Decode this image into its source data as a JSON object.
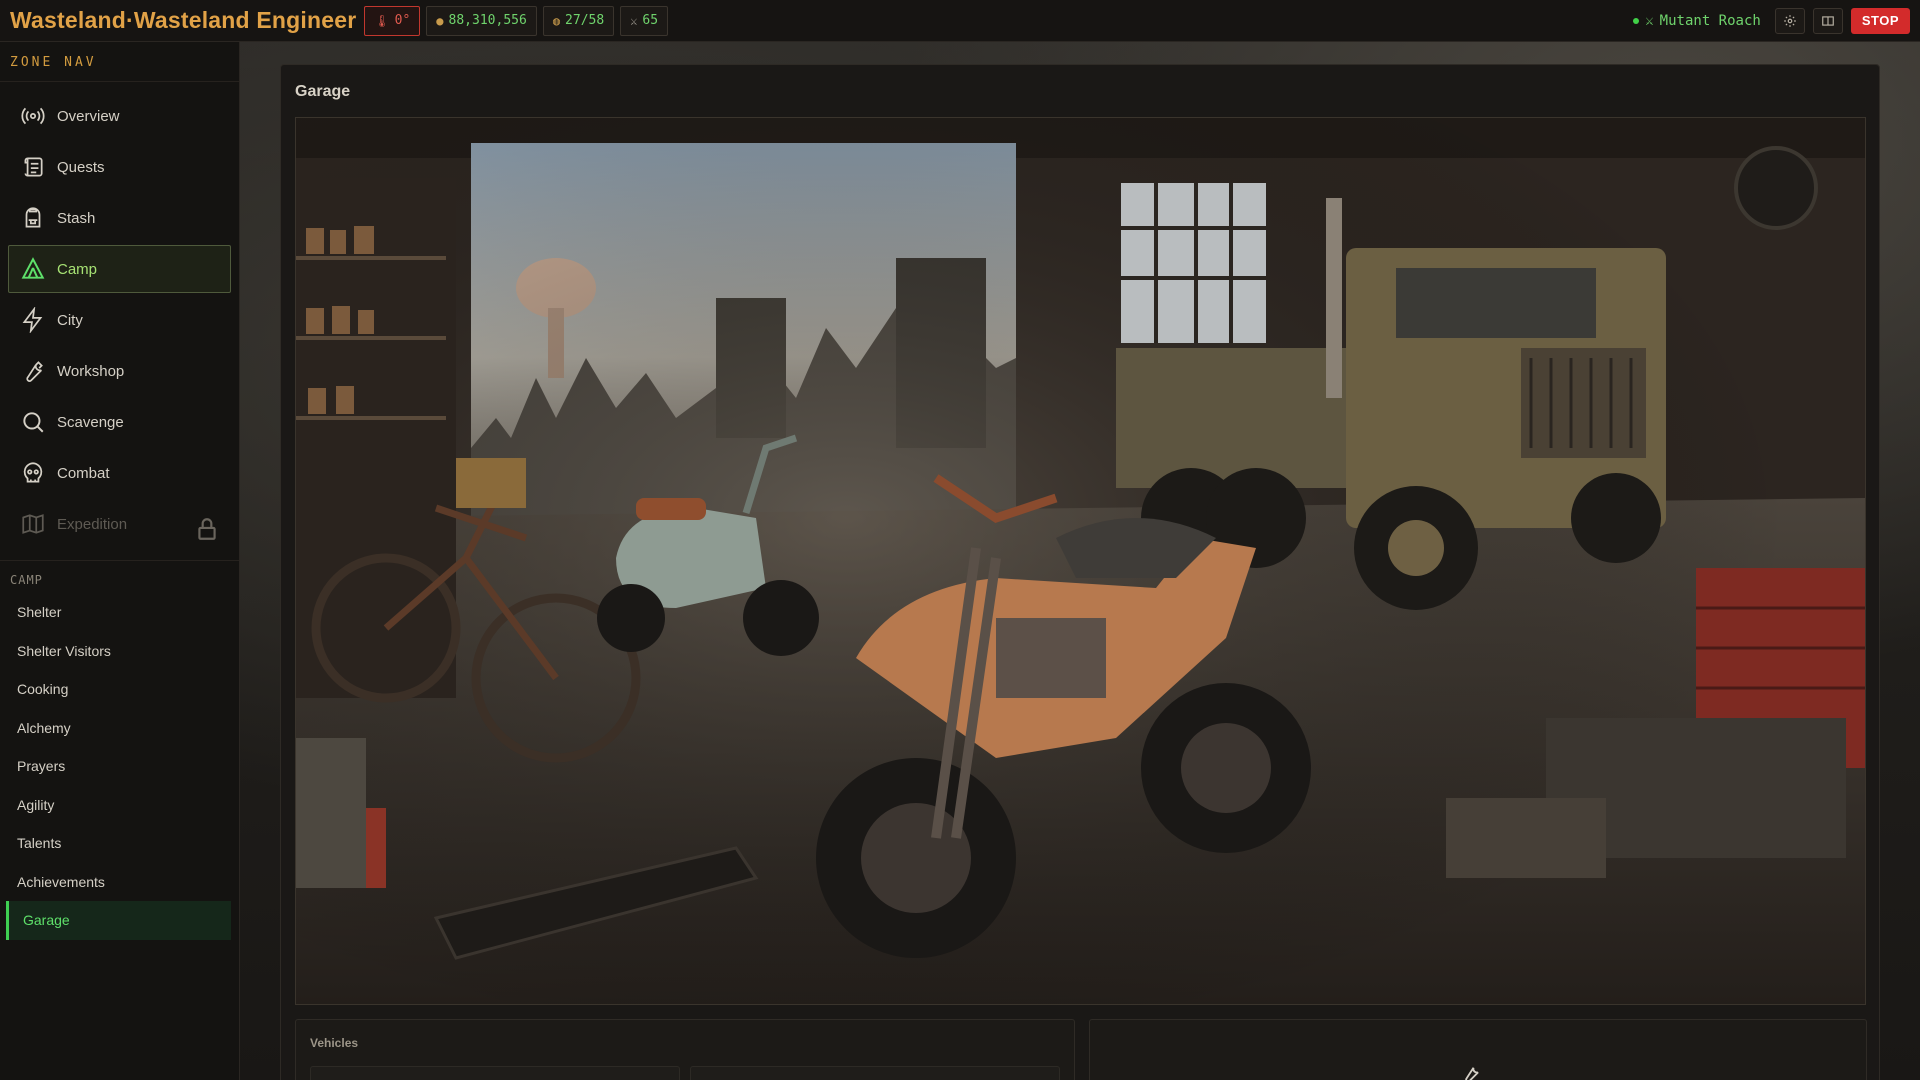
{
  "app": {
    "title": "Wasteland·Wasteland Engineer"
  },
  "topbar": {
    "stats": [
      {
        "icon": "thermometer-icon",
        "value": "0°",
        "alert": true
      },
      {
        "icon": "coin-icon",
        "value": "88,310,556"
      },
      {
        "icon": "capacity-icon",
        "value": "27/58"
      },
      {
        "icon": "swords-icon",
        "value": "65"
      }
    ],
    "enemy_label": "Mutant Roach",
    "stop_label": "STOP"
  },
  "sidebar": {
    "zone_nav_title": "ZONE NAV",
    "items": [
      {
        "label": "Overview",
        "icon": "radar-icon"
      },
      {
        "label": "Quests",
        "icon": "scroll-icon"
      },
      {
        "label": "Stash",
        "icon": "backpack-icon"
      },
      {
        "label": "Camp",
        "icon": "tent-icon",
        "active": true
      },
      {
        "label": "City",
        "icon": "lightning-icon"
      },
      {
        "label": "Workshop",
        "icon": "wrench-icon"
      },
      {
        "label": "Scavenge",
        "icon": "magnifier-icon"
      },
      {
        "label": "Combat",
        "icon": "skull-icon"
      },
      {
        "label": "Expedition",
        "icon": "map-icon",
        "locked": true
      }
    ],
    "camp_title": "CAMP",
    "camp_items": [
      {
        "label": "Shelter"
      },
      {
        "label": "Shelter Visitors"
      },
      {
        "label": "Cooking"
      },
      {
        "label": "Alchemy"
      },
      {
        "label": "Prayers"
      },
      {
        "label": "Agility"
      },
      {
        "label": "Talents"
      },
      {
        "label": "Achievements"
      },
      {
        "label": "Garage",
        "active": true
      }
    ]
  },
  "main": {
    "panel_title": "Garage",
    "vehicles_title": "Vehicles"
  },
  "colors": {
    "accent_orange": "#e1a247",
    "active_green": "#5ee06a",
    "alert_red": "#d32b2b",
    "stat_green": "#6fd36c"
  }
}
